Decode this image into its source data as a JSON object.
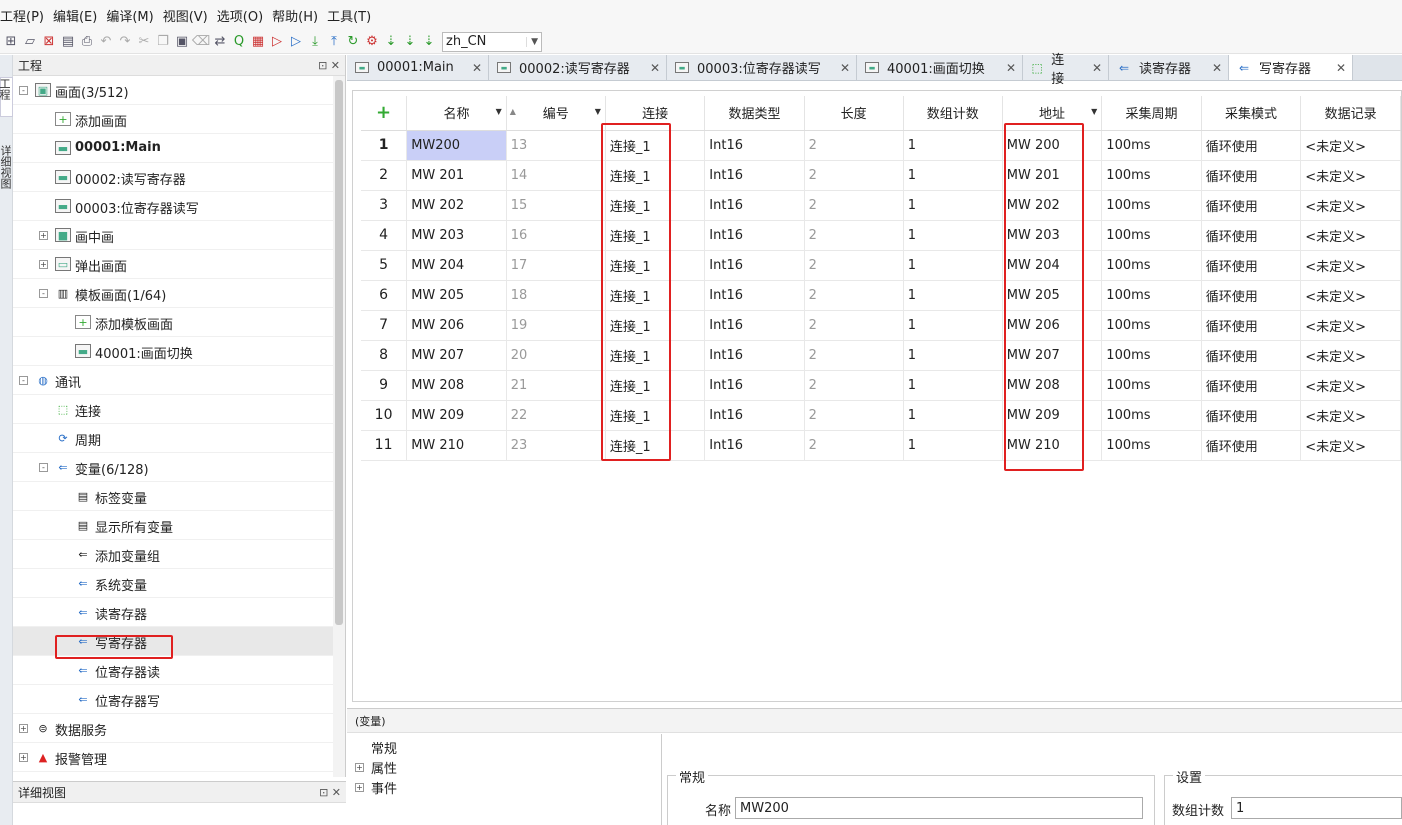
{
  "menu": [
    "工程(P)",
    "编辑(E)",
    "编译(M)",
    "视图(V)",
    "选项(O)",
    "帮助(H)",
    "工具(T)"
  ],
  "toolbar": {
    "language": "zh_CN",
    "icons": [
      "new-project-icon",
      "open-icon",
      "close-icon",
      "save-icon",
      "print-icon",
      "undo-icon",
      "redo-icon",
      "cut-icon",
      "copy-icon",
      "paste-icon",
      "delete-icon",
      "find-replace-icon",
      "search-icon",
      "compile-icon",
      "simulate-offline-icon",
      "simulate-online-icon",
      "download-icon",
      "upload-icon",
      "refresh-icon",
      "network-icon",
      "transfer-icon",
      "transfer2-icon",
      "transfer3-icon"
    ]
  },
  "side_tabs": [
    "工程",
    "详细视图"
  ],
  "project_panel": {
    "title": "工程",
    "ctrl": "⊡ ✕",
    "nodes": [
      {
        "label": "画面(3/512)",
        "level": 0,
        "icon": "screen-folder-icon",
        "exp": "-",
        "bold": false
      },
      {
        "label": "添加画面",
        "level": 1,
        "icon": "add-screen-icon",
        "exp": "",
        "bold": false
      },
      {
        "label": "00001:Main",
        "level": 1,
        "icon": "screen-icon",
        "exp": "",
        "bold": true
      },
      {
        "label": "00002:读写寄存器",
        "level": 1,
        "icon": "screen-icon",
        "exp": "",
        "bold": false
      },
      {
        "label": "00003:位寄存器读写",
        "level": 1,
        "icon": "screen-icon",
        "exp": "",
        "bold": false
      },
      {
        "label": "画中画",
        "level": 1,
        "icon": "pip-icon",
        "exp": "+",
        "bold": false
      },
      {
        "label": "弹出画面",
        "level": 1,
        "icon": "popup-icon",
        "exp": "+",
        "bold": false
      },
      {
        "label": "模板画面(1/64)",
        "level": 1,
        "icon": "template-icon",
        "exp": "-",
        "bold": false
      },
      {
        "label": "添加模板画面",
        "level": 2,
        "icon": "add-template-icon",
        "exp": "",
        "bold": false
      },
      {
        "label": "40001:画面切换",
        "level": 2,
        "icon": "screen-icon",
        "exp": "",
        "bold": false
      },
      {
        "label": "通讯",
        "level": 0,
        "icon": "globe-icon",
        "exp": "-",
        "bold": false
      },
      {
        "label": "连接",
        "level": 1,
        "icon": "connection-icon",
        "exp": "",
        "bold": false
      },
      {
        "label": "周期",
        "level": 1,
        "icon": "cycle-icon",
        "exp": "",
        "bold": false
      },
      {
        "label": "变量(6/128)",
        "level": 1,
        "icon": "variable-folder-icon",
        "exp": "-",
        "bold": false
      },
      {
        "label": "标签变量",
        "level": 2,
        "icon": "tag-variable-icon",
        "exp": "",
        "bold": false
      },
      {
        "label": "显示所有变量",
        "level": 2,
        "icon": "show-all-variables-icon",
        "exp": "",
        "bold": false
      },
      {
        "label": "添加变量组",
        "level": 2,
        "icon": "add-variable-group-icon",
        "exp": "",
        "bold": false
      },
      {
        "label": "系统变量",
        "level": 2,
        "icon": "variable-table-icon",
        "exp": "",
        "bold": false
      },
      {
        "label": "读寄存器",
        "level": 2,
        "icon": "variable-table-icon",
        "exp": "",
        "bold": false
      },
      {
        "label": "写寄存器",
        "level": 2,
        "icon": "variable-table-icon",
        "exp": "",
        "bold": false
      },
      {
        "label": "位寄存器读",
        "level": 2,
        "icon": "variable-table-icon",
        "exp": "",
        "bold": false
      },
      {
        "label": "位寄存器写",
        "level": 2,
        "icon": "variable-table-icon",
        "exp": "",
        "bold": false
      },
      {
        "label": "数据服务",
        "level": 0,
        "icon": "database-icon",
        "exp": "+",
        "bold": false
      },
      {
        "label": "报警管理",
        "level": 0,
        "icon": "alarm-warning-icon",
        "exp": "+",
        "bold": false
      }
    ]
  },
  "detail_panel": {
    "title": "详细视图",
    "ctrl": "⊡ ✕"
  },
  "tabs": [
    {
      "label": "00001:Main",
      "icon": "screen"
    },
    {
      "label": "00002:读写寄存器",
      "icon": "screen"
    },
    {
      "label": "00003:位寄存器读写",
      "icon": "screen"
    },
    {
      "label": "40001:画面切换",
      "icon": "screen"
    },
    {
      "label": "连接",
      "icon": "conn"
    },
    {
      "label": "读寄存器",
      "icon": "var"
    },
    {
      "label": "写寄存器",
      "icon": "var",
      "active": true
    }
  ],
  "grid": {
    "add_symbol": "+",
    "columns": [
      "名称",
      "编号",
      "连接",
      "数据类型",
      "长度",
      "数组计数",
      "地址",
      "采集周期",
      "采集模式",
      "数据记录"
    ],
    "rows": [
      [
        "1",
        "MW200",
        "13",
        "连接_1",
        "Int16",
        "2",
        "1",
        "MW 200",
        "100ms",
        "循环使用",
        "<未定义>"
      ],
      [
        "2",
        "MW 201",
        "14",
        "连接_1",
        "Int16",
        "2",
        "1",
        "MW 201",
        "100ms",
        "循环使用",
        "<未定义>"
      ],
      [
        "3",
        "MW 202",
        "15",
        "连接_1",
        "Int16",
        "2",
        "1",
        "MW 202",
        "100ms",
        "循环使用",
        "<未定义>"
      ],
      [
        "4",
        "MW 203",
        "16",
        "连接_1",
        "Int16",
        "2",
        "1",
        "MW 203",
        "100ms",
        "循环使用",
        "<未定义>"
      ],
      [
        "5",
        "MW 204",
        "17",
        "连接_1",
        "Int16",
        "2",
        "1",
        "MW 204",
        "100ms",
        "循环使用",
        "<未定义>"
      ],
      [
        "6",
        "MW 205",
        "18",
        "连接_1",
        "Int16",
        "2",
        "1",
        "MW 205",
        "100ms",
        "循环使用",
        "<未定义>"
      ],
      [
        "7",
        "MW 206",
        "19",
        "连接_1",
        "Int16",
        "2",
        "1",
        "MW 206",
        "100ms",
        "循环使用",
        "<未定义>"
      ],
      [
        "8",
        "MW 207",
        "20",
        "连接_1",
        "Int16",
        "2",
        "1",
        "MW 207",
        "100ms",
        "循环使用",
        "<未定义>"
      ],
      [
        "9",
        "MW 208",
        "21",
        "连接_1",
        "Int16",
        "2",
        "1",
        "MW 208",
        "100ms",
        "循环使用",
        "<未定义>"
      ],
      [
        "10",
        "MW 209",
        "22",
        "连接_1",
        "Int16",
        "2",
        "1",
        "MW 209",
        "100ms",
        "循环使用",
        "<未定义>"
      ],
      [
        "11",
        "MW 210",
        "23",
        "连接_1",
        "Int16",
        "2",
        "1",
        "MW 210",
        "100ms",
        "循环使用",
        "<未定义>"
      ]
    ]
  },
  "properties": {
    "header": "(变量)",
    "tree": [
      "常规",
      "属性",
      "事件"
    ],
    "general_group": "常规",
    "name_label": "名称",
    "name_value": "MW200",
    "settings_group": "设置",
    "array_label": "数组计数",
    "array_value": "1"
  }
}
